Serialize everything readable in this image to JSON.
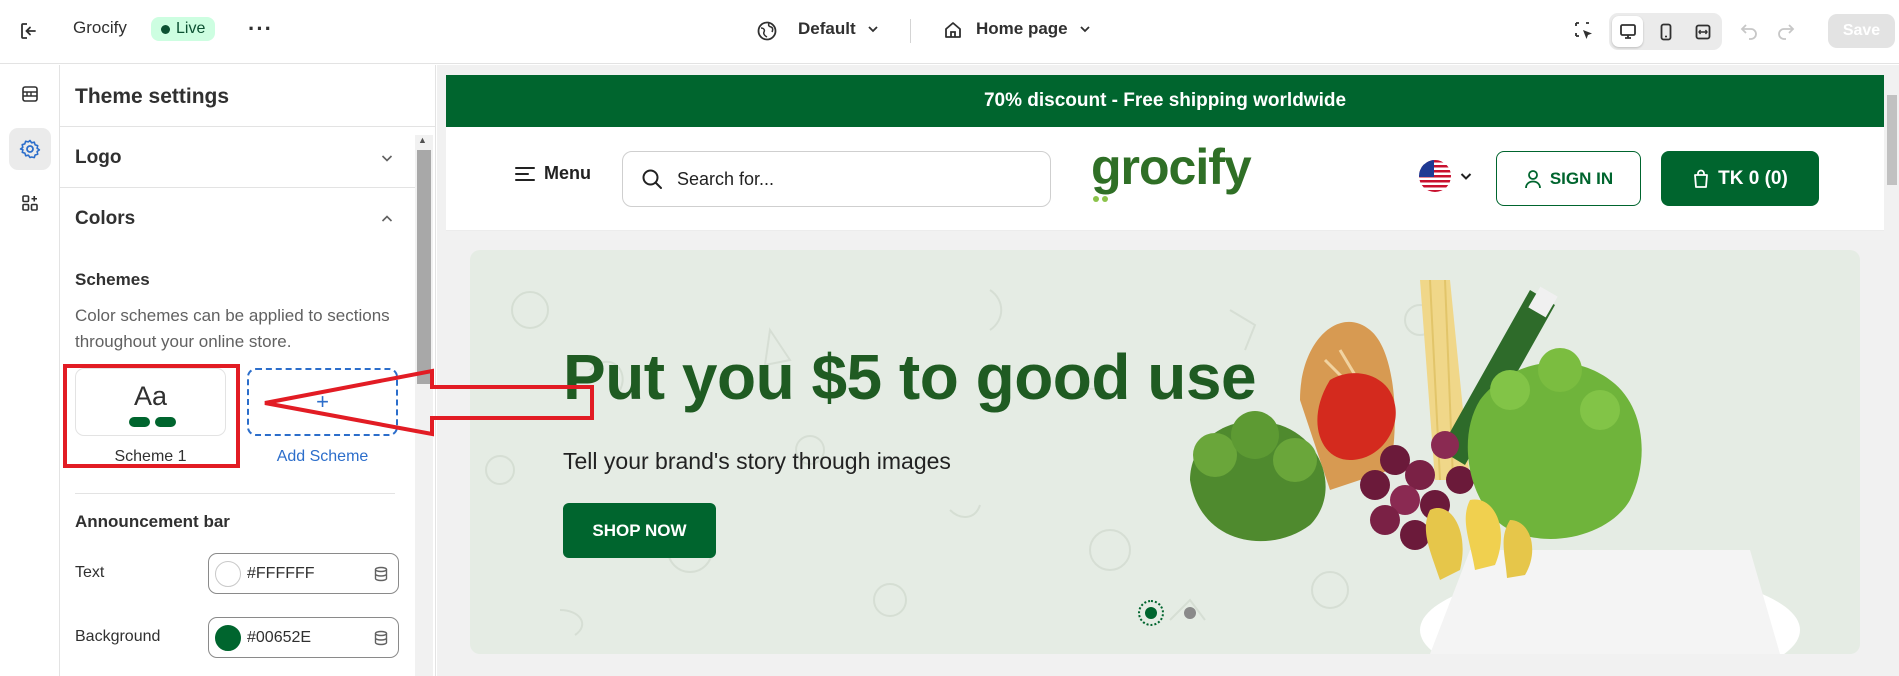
{
  "topbar": {
    "store_name": "Grocify",
    "live_badge": "Live",
    "theme_select": "Default",
    "page_select": "Home page",
    "save_label": "Save",
    "icons": [
      "exit-icon",
      "more-icon",
      "globe-icon",
      "home-icon",
      "inspector-icon",
      "desktop-icon",
      "mobile-icon",
      "fullwidth-icon",
      "undo-icon",
      "redo-icon"
    ]
  },
  "sidebar_rail": {
    "items": [
      "sections-icon",
      "settings-icon",
      "apps-icon"
    ],
    "active": "settings-icon"
  },
  "panel": {
    "title": "Theme settings",
    "sections": [
      {
        "label": "Logo",
        "expanded": false
      },
      {
        "label": "Colors",
        "expanded": true
      }
    ],
    "schemes": {
      "heading": "Schemes",
      "help": "Color schemes can be applied to sections throughout your online store.",
      "scheme_preview": "Aa",
      "scheme_name": "Scheme 1",
      "add_glyph": "+",
      "add_label": "Add Scheme"
    },
    "announcement": {
      "heading": "Announcement bar",
      "text_label": "Text",
      "text_value": "#FFFFFF",
      "text_color": "#FFFFFF",
      "background_label": "Background",
      "background_value": "#00652E",
      "background_color": "#00652E"
    }
  },
  "preview": {
    "announcement": "70% discount - Free shipping worldwide",
    "menu_label": "Menu",
    "search_placeholder": "Search for...",
    "logo_text": "grocify",
    "sign_in": "SIGN IN",
    "cart": "TK 0 (0)",
    "hero": {
      "title": "Put you $5 to good use",
      "subtitle": "Tell your brand's story through images",
      "button": "SHOP NOW",
      "slides": 2,
      "active_slide": 1
    }
  },
  "colors": {
    "brand_green": "#00652E",
    "annotation_red": "#E21C24",
    "link_blue": "#2C6ECB"
  }
}
